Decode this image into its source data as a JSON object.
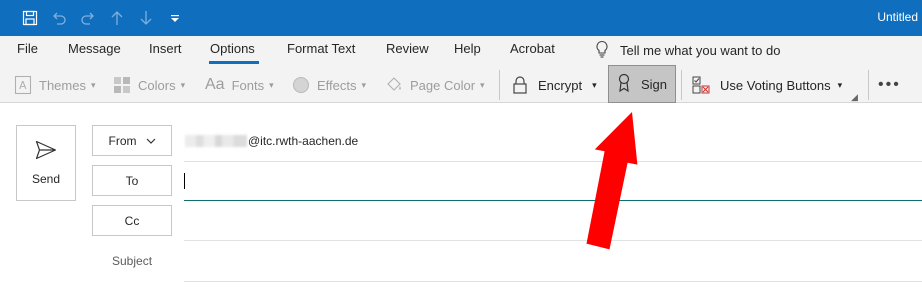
{
  "window": {
    "title": "Untitled"
  },
  "quick_access": [
    {
      "name": "save-icon"
    },
    {
      "name": "undo-icon"
    },
    {
      "name": "redo-icon"
    },
    {
      "name": "up-arrow-icon"
    },
    {
      "name": "down-arrow-icon"
    },
    {
      "name": "customize-qat-icon"
    }
  ],
  "tabs": [
    "File",
    "Message",
    "Insert",
    "Options",
    "Format Text",
    "Review",
    "Help",
    "Acrobat"
  ],
  "active_tab": "Options",
  "tell_me": "Tell me what you want to do",
  "ribbon": {
    "themes": "Themes",
    "colors": "Colors",
    "fonts": "Fonts",
    "effects": "Effects",
    "page_color": "Page Color",
    "encrypt": "Encrypt",
    "sign": "Sign",
    "voting": "Use Voting Buttons"
  },
  "compose": {
    "send": "Send",
    "from": "From",
    "from_email": "@itc.rwth-aachen.de",
    "to": "To",
    "cc": "Cc",
    "subject": "Subject"
  },
  "colors": {
    "titlebar": "#106ebe",
    "annotation_arrow": "#ff0000"
  }
}
